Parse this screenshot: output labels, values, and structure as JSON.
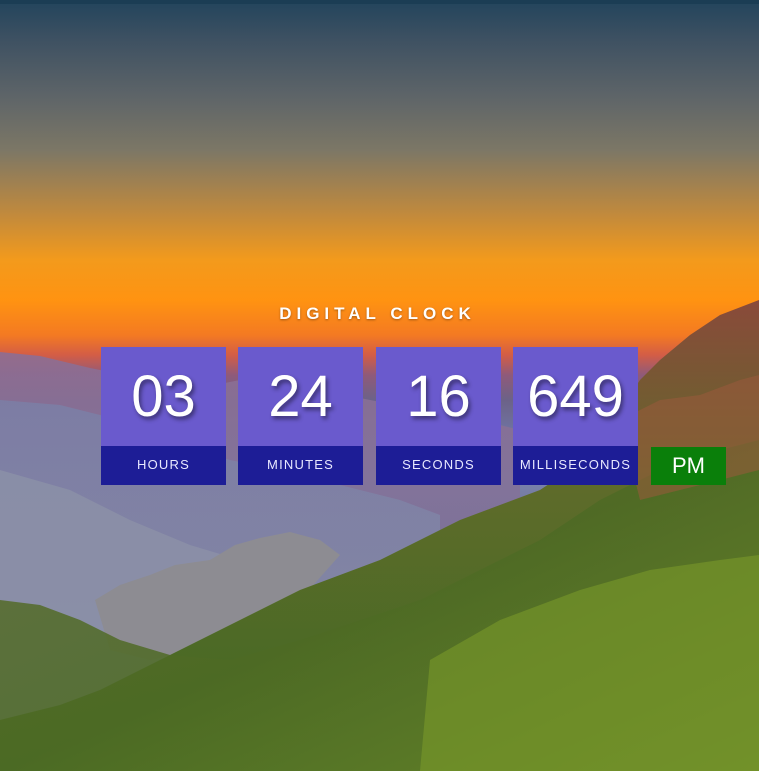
{
  "clock": {
    "title": "DIGITAL CLOCK",
    "units": [
      {
        "value": "03",
        "label": "HOURS"
      },
      {
        "value": "24",
        "label": "MINUTES"
      },
      {
        "value": "16",
        "label": "SECONDS"
      },
      {
        "value": "649",
        "label": "MILLISECONDS"
      }
    ],
    "meridiem": "PM"
  },
  "colors": {
    "tile_top": "#6a5acd",
    "tile_label": "#1d1d96",
    "meridiem_bg": "#0a7f0a",
    "text": "#ffffff"
  }
}
